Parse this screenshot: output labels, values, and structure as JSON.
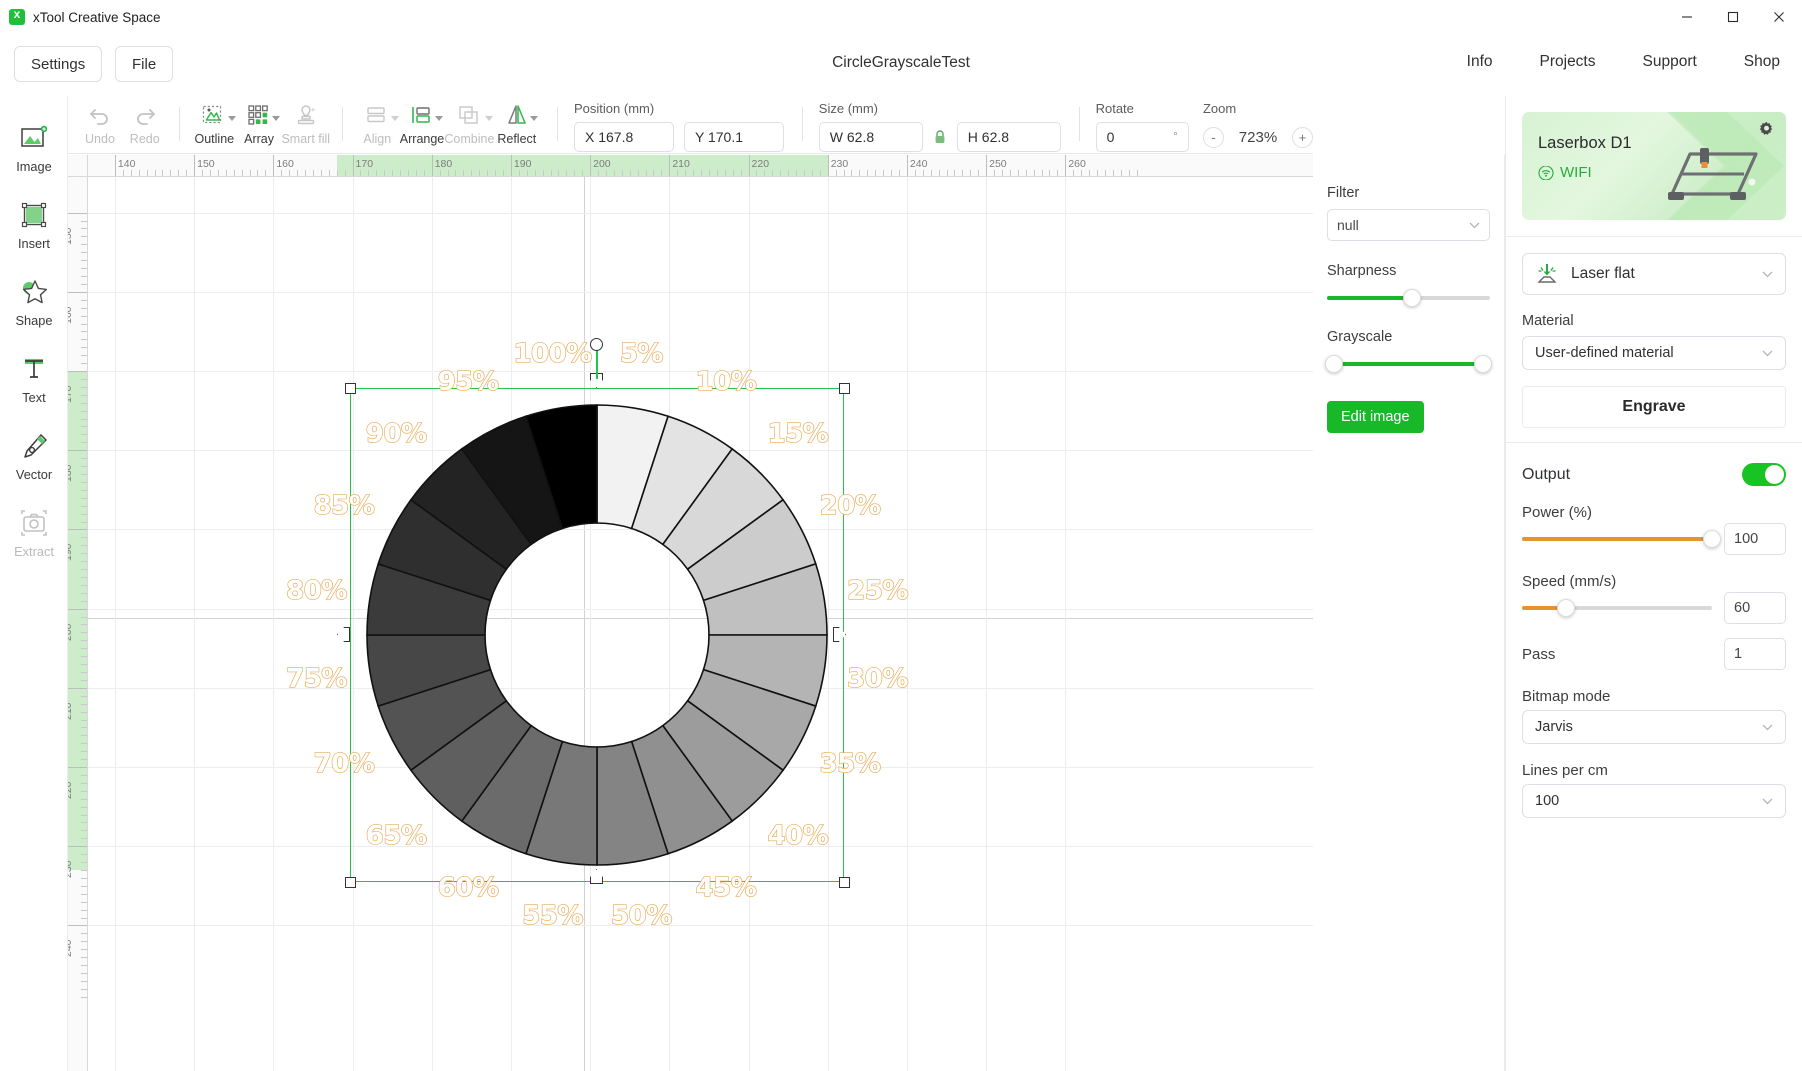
{
  "window": {
    "app_title": "xTool Creative Space",
    "logo_icon": "xtool-logo-icon",
    "minimize": "—",
    "maximize": "☐",
    "close": "✕"
  },
  "menu": {
    "settings_label": "Settings",
    "file_label": "File",
    "document_title": "CircleGrayscaleTest",
    "nav": [
      {
        "label": "Info"
      },
      {
        "label": "Projects"
      },
      {
        "label": "Support"
      },
      {
        "label": "Shop"
      }
    ]
  },
  "rail": {
    "items": [
      {
        "label": "Image",
        "icon": "image-add-icon",
        "disabled": false
      },
      {
        "label": "Insert",
        "icon": "insert-shape-icon",
        "disabled": false
      },
      {
        "label": "Shape",
        "icon": "star-shape-icon",
        "disabled": false
      },
      {
        "label": "Text",
        "icon": "text-tool-icon",
        "disabled": false
      },
      {
        "label": "Vector",
        "icon": "pen-vector-icon",
        "disabled": false
      },
      {
        "label": "Extract",
        "icon": "camera-extract-icon",
        "disabled": true
      }
    ]
  },
  "toolbar": {
    "tools": [
      {
        "label": "Undo",
        "icon": "undo-icon",
        "disabled": true,
        "caret": false
      },
      {
        "label": "Redo",
        "icon": "redo-icon",
        "disabled": true,
        "caret": false
      },
      {
        "label": "Outline",
        "icon": "outline-icon",
        "disabled": false,
        "caret": true
      },
      {
        "label": "Array",
        "icon": "array-grid-icon",
        "disabled": false,
        "caret": true
      },
      {
        "label": "Smart fill",
        "icon": "smart-fill-icon",
        "disabled": true,
        "caret": false
      },
      {
        "label": "Align",
        "icon": "align-icon",
        "disabled": true,
        "caret": true
      },
      {
        "label": "Arrange",
        "icon": "arrange-icon",
        "disabled": false,
        "caret": true
      },
      {
        "label": "Combine",
        "icon": "combine-icon",
        "disabled": true,
        "caret": true
      },
      {
        "label": "Reflect",
        "icon": "reflect-icon",
        "disabled": false,
        "caret": true
      }
    ],
    "position_label": "Position (mm)",
    "x_value": "X 167.8",
    "y_value": "Y 170.1",
    "size_label": "Size (mm)",
    "w_value": "W 62.8",
    "h_value": "H 62.8",
    "lock_icon": "lock-aspect-icon",
    "rotate_label": "Rotate",
    "rotate_value": "0",
    "rotate_unit": "°",
    "zoom_label": "Zoom",
    "zoom_minus": "-",
    "zoom_value": "723%",
    "zoom_plus": "+"
  },
  "canvas": {
    "ruler_h_ticks": [
      "140",
      "150",
      "160",
      "170",
      "180",
      "190",
      "200",
      "210",
      "220",
      "230",
      "240",
      "250",
      "260"
    ],
    "ruler_v_ticks": [
      "150",
      "160",
      "170",
      "180",
      "190",
      "200",
      "210",
      "220",
      "230",
      "240"
    ],
    "highlight_h": {
      "from": "168",
      "to": "230"
    },
    "highlight_v": {
      "from": "170",
      "to": "233"
    }
  },
  "chart_data": {
    "type": "pie",
    "title": "CircleGrayscaleTest",
    "subtype": "donut-grayscale-wedges",
    "labels": [
      "5%",
      "10%",
      "15%",
      "20%",
      "25%",
      "30%",
      "35%",
      "40%",
      "45%",
      "50%",
      "55%",
      "60%",
      "65%",
      "70%",
      "75%",
      "80%",
      "85%",
      "90%",
      "95%",
      "100%"
    ],
    "values": [
      5,
      5,
      5,
      5,
      5,
      5,
      5,
      5,
      5,
      5,
      5,
      5,
      5,
      5,
      5,
      5,
      5,
      5,
      5,
      5
    ],
    "segment_fills": [
      "#f2f2f2",
      "#e3e3e3",
      "#d8d8d8",
      "#cccccc",
      "#c0c0c0",
      "#b4b4b4",
      "#a8a8a8",
      "#9c9c9c",
      "#909090",
      "#848484",
      "#787878",
      "#6b6b6b",
      "#5f5f5f",
      "#535353",
      "#474747",
      "#3b3b3b",
      "#2f2f2f",
      "#232323",
      "#151515",
      "#000000"
    ],
    "label_color": "#e8a951",
    "legend": "none",
    "grid": true
  },
  "filter_panel": {
    "filter_label": "Filter",
    "filter_value": "null",
    "sharpness_label": "Sharpness",
    "sharpness_pct": 52,
    "grayscale_label": "Grayscale",
    "grayscale_low_pct": 4,
    "grayscale_high_pct": 96,
    "edit_image_label": "Edit image",
    "accent_green": "#18b828"
  },
  "right_panel": {
    "device_name": "Laserbox D1",
    "connection": "WIFI",
    "wifi_icon": "wifi-icon",
    "gear_icon": "gear-icon",
    "device_image": "laser-engraver-icon",
    "mode_label": "Laser flat",
    "mode_icon": "laser-flat-icon",
    "material_label": "Material",
    "material_value": "User-defined material",
    "process_tab": "Engrave",
    "output_label": "Output",
    "output_on": true,
    "power_label": "Power (%)",
    "power_value": "100",
    "power_pct": 100,
    "speed_label": "Speed (mm/s)",
    "speed_value": "60",
    "speed_pct": 23,
    "pass_label": "Pass",
    "pass_value": "1",
    "bitmap_label": "Bitmap mode",
    "bitmap_value": "Jarvis",
    "lines_label": "Lines per cm",
    "lines_value": "100",
    "accent_orange": "#e8922e",
    "accent_green": "#18c424"
  }
}
